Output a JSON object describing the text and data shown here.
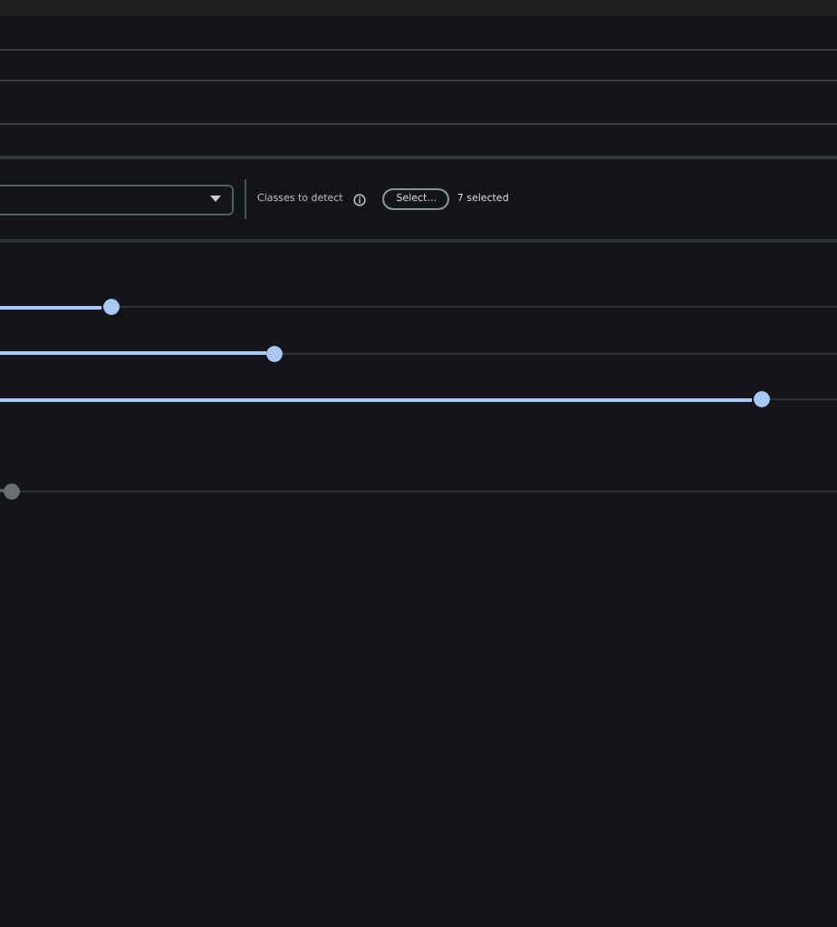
{
  "detection": {
    "label": "Classes to detect",
    "button": "Select...",
    "count": "7 selected"
  },
  "sliders": [
    {
      "level": 0.132,
      "disabled": false
    },
    {
      "level": 0.327,
      "disabled": false
    },
    {
      "level": 0.909,
      "disabled": false
    },
    {
      "level": 0.013,
      "disabled": true
    }
  ]
}
